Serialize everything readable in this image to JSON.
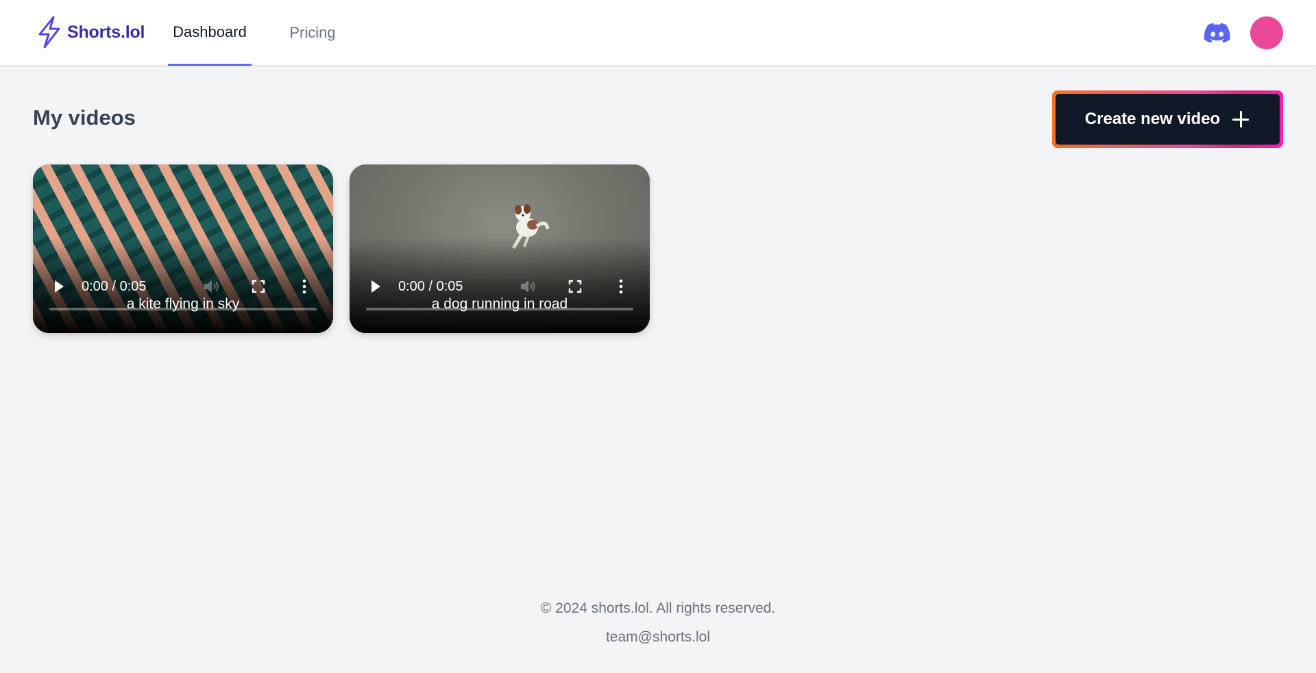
{
  "brand": {
    "name": "Shorts.lol",
    "logo_icon": "lightning-bolt-icon",
    "color": "#3730a3"
  },
  "nav": {
    "tabs": [
      {
        "label": "Dashboard",
        "active": true
      },
      {
        "label": "Pricing",
        "active": false
      }
    ],
    "accent": "#6366f1"
  },
  "header_right": {
    "discord_icon": "discord-icon",
    "avatar_color": "#ec4899"
  },
  "main": {
    "title": "My videos",
    "create_button": {
      "label": "Create new video",
      "icon": "plus-icon"
    },
    "videos": [
      {
        "caption": "a kite flying in sky",
        "time": "0:00 / 0:05"
      },
      {
        "caption": "a dog running in road",
        "time": "0:00 / 0:05"
      }
    ]
  },
  "footer": {
    "copyright": "© 2024 shorts.lol. All rights reserved.",
    "email": "team@shorts.lol"
  }
}
